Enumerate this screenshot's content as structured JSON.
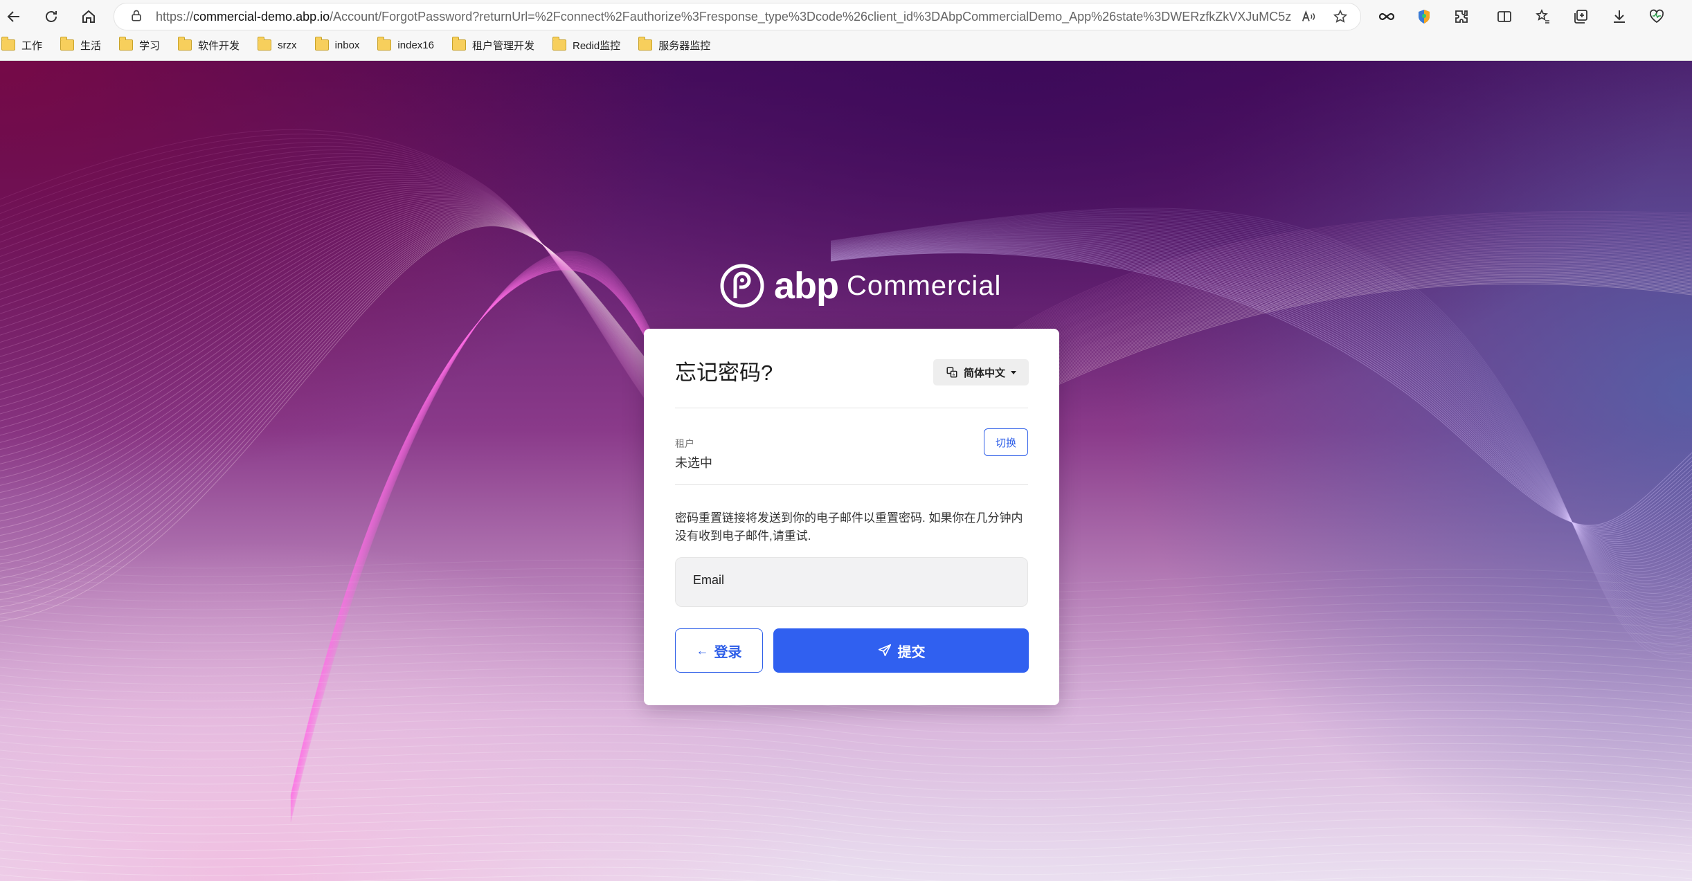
{
  "browser": {
    "url_prefix": "https://",
    "url_host": "commercial-demo.abp.io",
    "url_path": "/Account/ForgotPassword?returnUrl=%2Fconnect%2Fauthorize%3Fresponse_type%3Dcode%26client_id%3DAbpCommercialDemo_App%26state%3DWERzfkZkVXJuMC5zUWMw...",
    "bookmarks": [
      "工作",
      "生活",
      "学习",
      "软件开发",
      "srzx",
      "inbox",
      "index16",
      "租户管理开发",
      "Redid监控",
      "服务器监控"
    ]
  },
  "brand": {
    "abp": "abp",
    "name": "Commercial"
  },
  "card": {
    "title": "忘记密码?",
    "language": "简体中文",
    "tenant_label": "租户",
    "tenant_value": "未选中",
    "switch_label": "切换",
    "info_text": "密码重置链接将发送到你的电子邮件以重置密码. 如果你在几分钟内没有收到电子邮件,请重试.",
    "email_placeholder": "Email",
    "login_label": "登录",
    "submit_label": "提交"
  },
  "colors": {
    "primary": "#3060f0",
    "card_bg": "#ffffff"
  }
}
